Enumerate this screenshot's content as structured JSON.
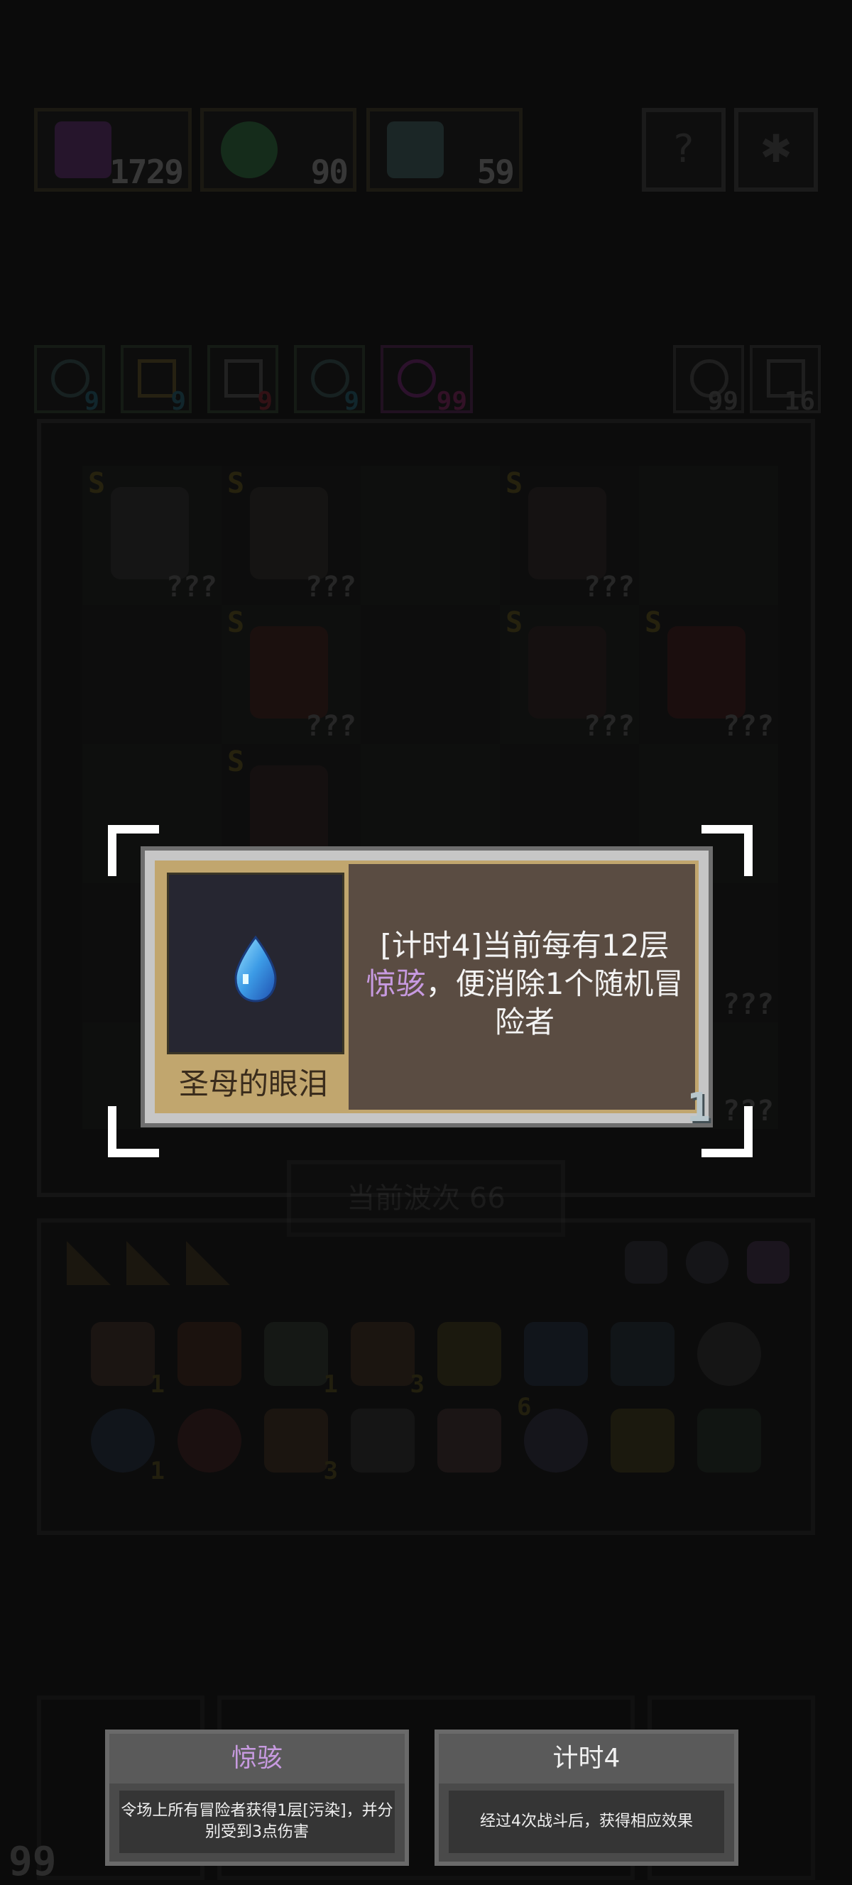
{
  "resources": [
    {
      "name": "purple-gem",
      "value": "1729",
      "color": "#5a2a6a"
    },
    {
      "name": "rainbow-ring",
      "value": "90",
      "color": "#2a6a3a"
    },
    {
      "name": "skull-face",
      "value": "59",
      "color": "#3a5a5a"
    }
  ],
  "stats": [
    {
      "value": "9",
      "color": "#1e5a6a"
    },
    {
      "value": "9",
      "color": "#1e5a6a"
    },
    {
      "value": "9",
      "color": "#7a1e2a"
    },
    {
      "value": "9",
      "color": "#1e5a6a"
    },
    {
      "value": "99",
      "color": "#7a1e5a"
    }
  ],
  "counters": [
    {
      "value": "99"
    },
    {
      "value": "16"
    }
  ],
  "board": {
    "hero_rank": "S",
    "hero_unknown": "???"
  },
  "wave": {
    "label": "当前波次 66"
  },
  "inventory": {
    "counts": [
      "1",
      "1",
      "3",
      "1",
      "3",
      "6"
    ]
  },
  "popup": {
    "item_name": "圣母的眼泪",
    "desc_prefix": "[计时4]当前每有12层",
    "desc_keyword": "惊骇",
    "desc_suffix": "，便消除1个随机冒险者",
    "level": "1"
  },
  "keywords": [
    {
      "title": "惊骇",
      "desc": "令场上所有冒险者获得1层[污染]，并分别受到3点伤害",
      "title_color": "#c79ae0"
    },
    {
      "title": "计时4",
      "desc": "经过4次战斗后，获得相应效果",
      "title_color": "#f0f0f0"
    }
  ],
  "footer": {
    "left_counter": "99"
  }
}
